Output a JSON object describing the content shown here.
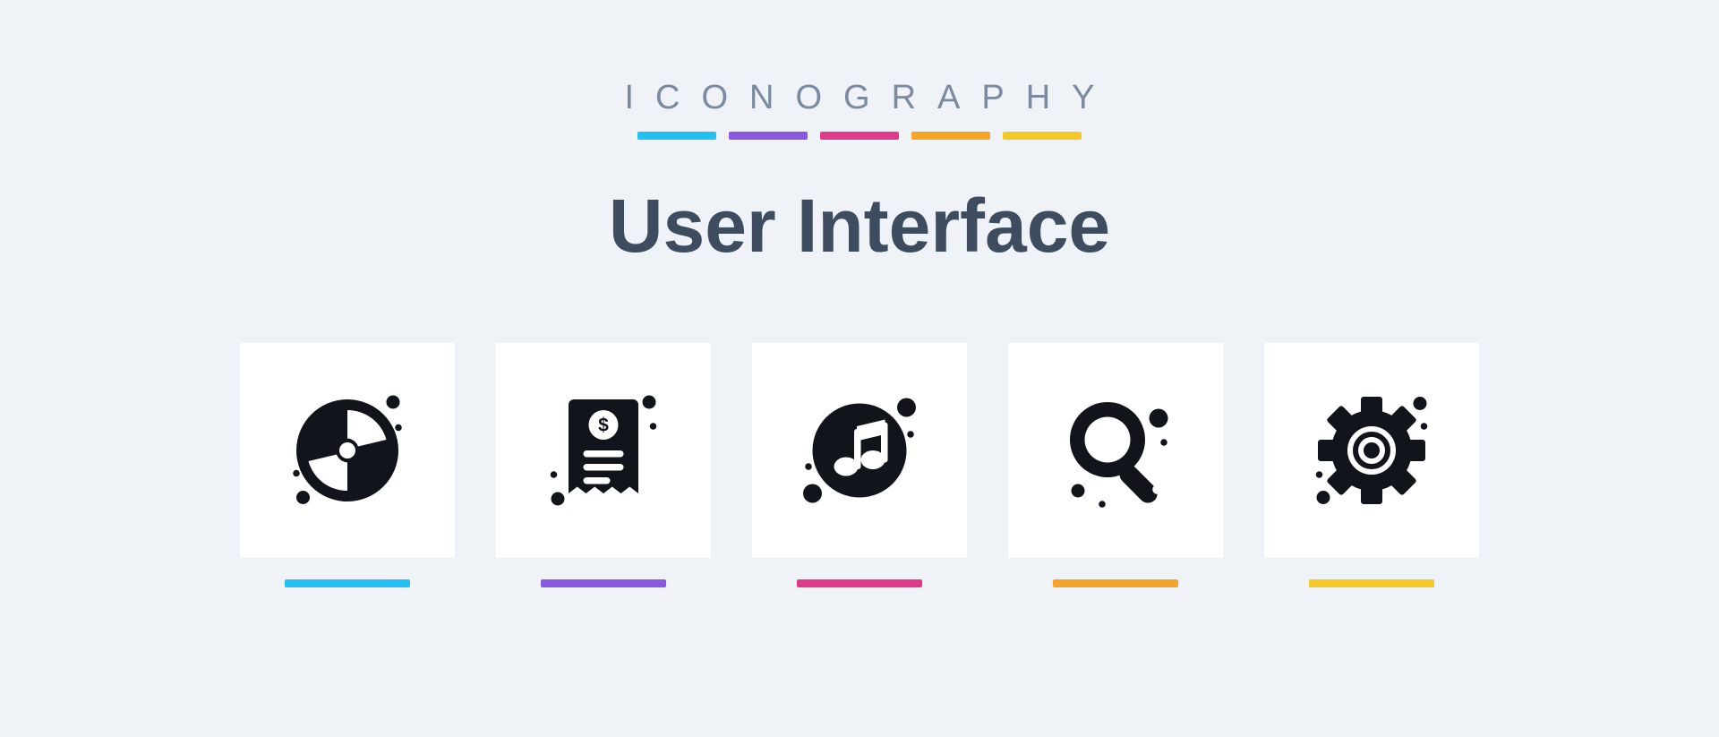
{
  "header": {
    "overline": "ICONOGRAPHY",
    "title": "User Interface"
  },
  "colors": {
    "blue": "#20c0f4",
    "purple": "#8a57e0",
    "pink": "#e13a8b",
    "orange": "#f5a428",
    "yellow": "#f6c827",
    "glyph": "#12141c",
    "text_muted": "#7a8aa0",
    "text_title": "#3d4c5e",
    "card_bg": "#ffffff",
    "page_bg": "#eff2f7"
  },
  "icons": [
    {
      "name": "disc-icon",
      "underline_color": "blue"
    },
    {
      "name": "receipt-icon",
      "underline_color": "purple"
    },
    {
      "name": "music-icon",
      "underline_color": "pink"
    },
    {
      "name": "search-icon",
      "underline_color": "orange"
    },
    {
      "name": "gear-icon",
      "underline_color": "yellow"
    }
  ]
}
